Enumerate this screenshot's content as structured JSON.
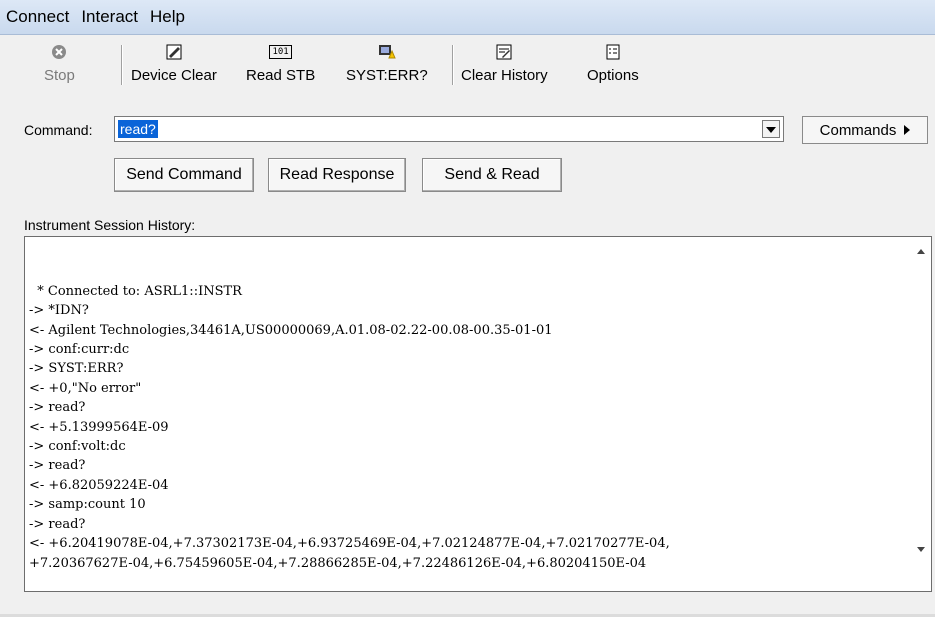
{
  "menu": [
    "Connect",
    "Interact",
    "Help"
  ],
  "toolbar": {
    "stop": {
      "label": "Stop",
      "icon": "stop-icon"
    },
    "device_clear": {
      "label": "Device Clear",
      "icon": "device-clear-icon"
    },
    "read_stb": {
      "label": "Read STB",
      "icon": "read-stb-icon",
      "icon_text": "101"
    },
    "syst_err": {
      "label": "SYST:ERR?",
      "icon": "syst-err-icon"
    },
    "clear_history": {
      "label": "Clear History",
      "icon": "clear-history-icon"
    },
    "options": {
      "label": "Options",
      "icon": "options-icon"
    }
  },
  "command": {
    "label": "Command:",
    "value": "read?",
    "commands_button": "Commands"
  },
  "actions": {
    "send_command": "Send Command",
    "read_response": "Read Response",
    "send_read": "Send & Read"
  },
  "history": {
    "label": "Instrument Session History:",
    "lines": [
      "  * Connected to: ASRL1::INSTR",
      "-> *IDN?",
      "<- Agilent Technologies,34461A,US00000069,A.01.08-02.22-00.08-00.35-01-01",
      "-> conf:curr:dc",
      "-> SYST:ERR?",
      "<- +0,\"No error\"",
      "-> read?",
      "<- +5.13999564E-09",
      "-> conf:volt:dc",
      "-> read?",
      "<- +6.82059224E-04",
      "-> samp:count 10",
      "-> read?",
      "<- +6.20419078E-04,+7.37302173E-04,+6.93725469E-04,+7.02124877E-04,+7.02170277E-04,",
      "+7.20367627E-04,+6.75459605E-04,+7.28866285E-04,+7.22486126E-04,+6.80204150E-04"
    ]
  },
  "colors": {
    "selection": "#0a64d8",
    "menubar": "#c9d9ee"
  }
}
